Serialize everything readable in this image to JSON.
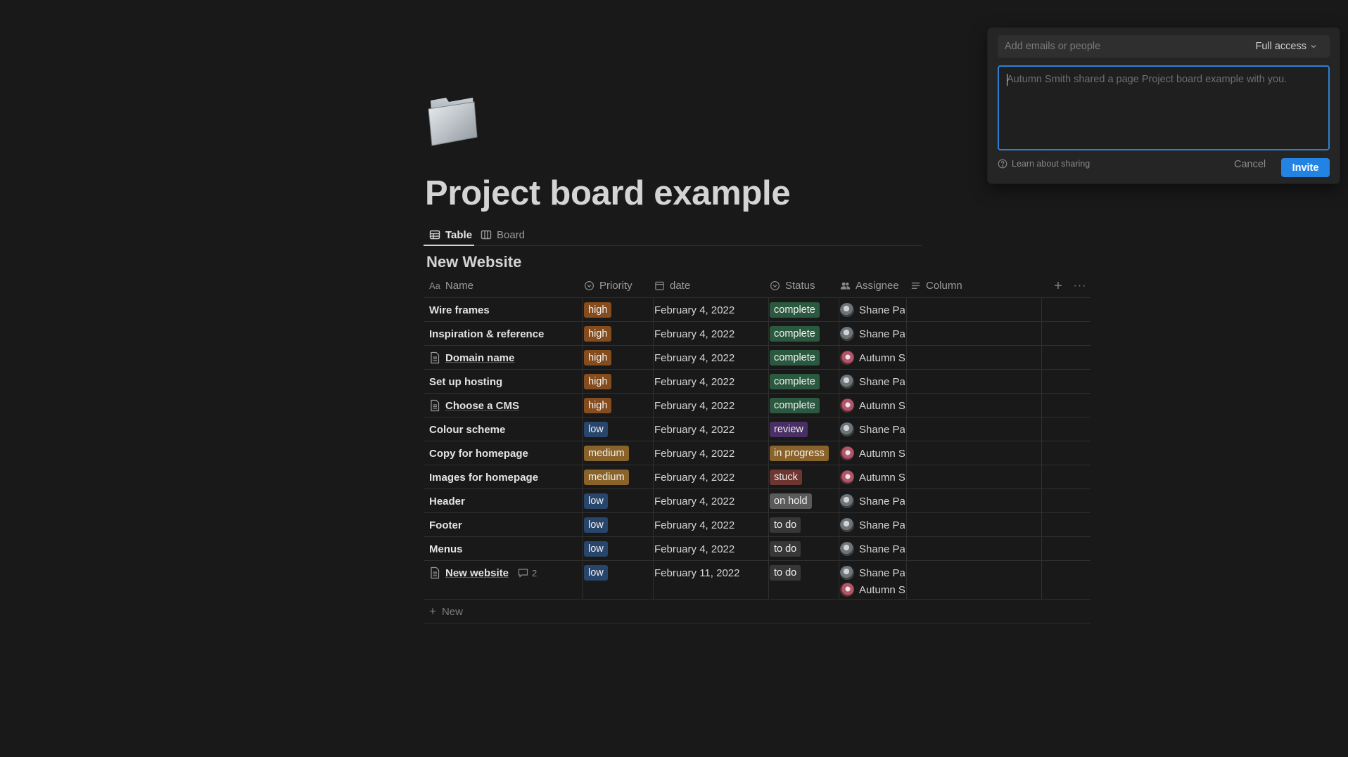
{
  "page": {
    "title": "Project board example",
    "icon": "folder-icon"
  },
  "tabs": [
    {
      "label": "Table",
      "icon": "table-icon",
      "active": true
    },
    {
      "label": "Board",
      "icon": "board-icon",
      "active": false
    }
  ],
  "database": {
    "title": "New Website",
    "columns": [
      {
        "label": "Name",
        "icon": "text-icon"
      },
      {
        "label": "Priority",
        "icon": "select-icon"
      },
      {
        "label": "date",
        "icon": "calendar-icon"
      },
      {
        "label": "Status",
        "icon": "select-icon"
      },
      {
        "label": "Assignee",
        "icon": "people-icon"
      },
      {
        "label": "Column",
        "icon": "text-lines-icon"
      }
    ],
    "rows": [
      {
        "name": "Wire frames",
        "doc": false,
        "priority": "high",
        "date": "February 4, 2022",
        "status": "complete",
        "assignees": [
          "Shane Par"
        ]
      },
      {
        "name": "Inspiration & reference",
        "doc": false,
        "priority": "high",
        "date": "February 4, 2022",
        "status": "complete",
        "assignees": [
          "Shane Par"
        ]
      },
      {
        "name": "Domain name",
        "doc": true,
        "priority": "high",
        "date": "February 4, 2022",
        "status": "complete",
        "assignees": [
          "Autumn Si"
        ]
      },
      {
        "name": "Set up hosting",
        "doc": false,
        "priority": "high",
        "date": "February 4, 2022",
        "status": "complete",
        "assignees": [
          "Shane Par"
        ]
      },
      {
        "name": "Choose a CMS",
        "doc": true,
        "priority": "high",
        "date": "February 4, 2022",
        "status": "complete",
        "assignees": [
          "Autumn Si"
        ]
      },
      {
        "name": "Colour scheme",
        "doc": false,
        "priority": "low",
        "date": "February 4, 2022",
        "status": "review",
        "assignees": [
          "Shane Par"
        ]
      },
      {
        "name": "Copy for homepage",
        "doc": false,
        "priority": "medium",
        "date": "February 4, 2022",
        "status": "in progress",
        "assignees": [
          "Autumn Si"
        ]
      },
      {
        "name": "Images for homepage",
        "doc": false,
        "priority": "medium",
        "date": "February 4, 2022",
        "status": "stuck",
        "assignees": [
          "Autumn Si"
        ]
      },
      {
        "name": "Header",
        "doc": false,
        "priority": "low",
        "date": "February 4, 2022",
        "status": "on hold",
        "assignees": [
          "Shane Par"
        ]
      },
      {
        "name": "Footer",
        "doc": false,
        "priority": "low",
        "date": "February 4, 2022",
        "status": "to do",
        "assignees": [
          "Shane Par"
        ]
      },
      {
        "name": "Menus",
        "doc": false,
        "priority": "low",
        "date": "February 4, 2022",
        "status": "to do",
        "assignees": [
          "Shane Par"
        ]
      },
      {
        "name": "New website",
        "doc": true,
        "comments": "2",
        "priority": "low",
        "date": "February 11, 2022",
        "status": "to do",
        "assignees": [
          "Shane Par",
          "Autumn Si"
        ]
      }
    ],
    "new_label": "New",
    "tag_colors": {
      "high": "#854c1d",
      "medium": "#89632a",
      "low": "#28456c",
      "complete": "#2b593f",
      "review": "#492f64",
      "in progress": "#89632a",
      "stuck": "#6e3630",
      "on hold": "#5a5a5a",
      "to do": "#373737"
    }
  },
  "share": {
    "input_placeholder": "Add emails or people",
    "access_label": "Full access",
    "message_placeholder": "Autumn Smith shared a page Project board example with you.",
    "learn_label": "Learn about sharing",
    "cancel_label": "Cancel",
    "invite_label": "Invite",
    "accent": "#2383e2"
  }
}
